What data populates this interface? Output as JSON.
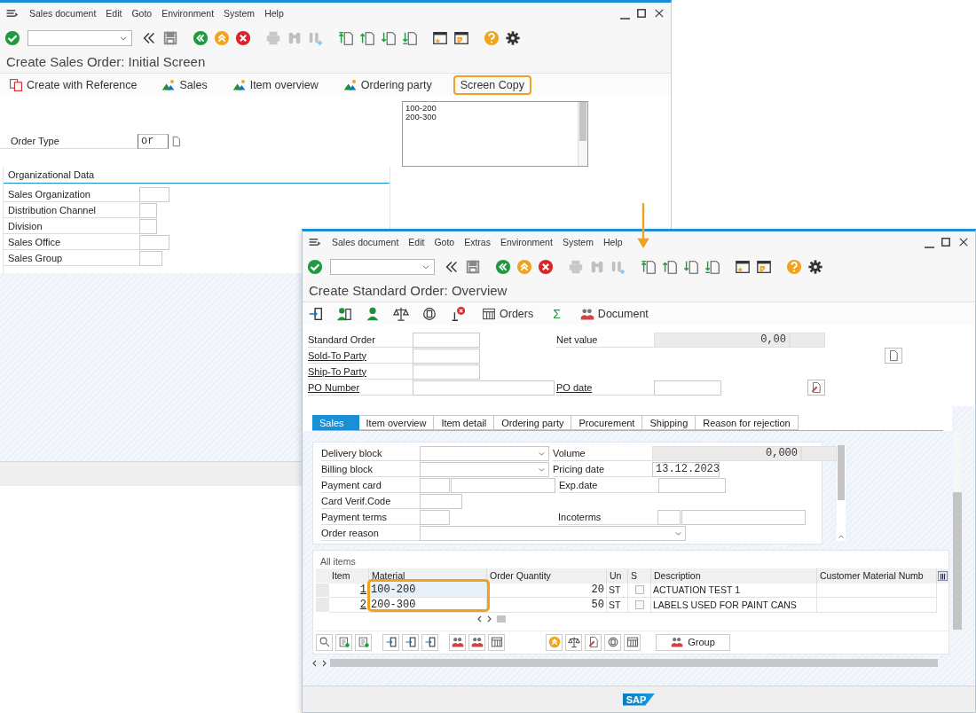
{
  "back_window": {
    "menu": [
      "Sales document",
      "Edit",
      "Goto",
      "Environment",
      "System",
      "Help"
    ],
    "title": "Create Sales Order: Initial Screen",
    "app_toolbar": [
      {
        "label": "Create with Reference",
        "kind": "reference",
        "highlighted": false
      },
      {
        "label": "Sales",
        "kind": "nav",
        "highlighted": false
      },
      {
        "label": "Item overview",
        "kind": "nav",
        "highlighted": false
      },
      {
        "label": "Ordering party",
        "kind": "nav",
        "highlighted": false
      },
      {
        "label": "Screen Copy",
        "kind": "plain",
        "highlighted": true
      }
    ],
    "order_type": {
      "label": "Order Type",
      "value": "or"
    },
    "org_data": {
      "title": "Organizational Data",
      "fields": [
        {
          "label": "Sales Organization"
        },
        {
          "label": "Distribution Channel"
        },
        {
          "label": "Division"
        },
        {
          "label": "Sales Office"
        },
        {
          "label": "Sales Group"
        }
      ]
    },
    "clipboard_list": [
      "100-200",
      "200-300"
    ]
  },
  "front_window": {
    "menu": [
      "Sales document",
      "Edit",
      "Goto",
      "Extras",
      "Environment",
      "System",
      "Help"
    ],
    "title": "Create Standard Order: Overview",
    "app_toolbar": [
      {
        "label": "Orders",
        "kind": "table"
      },
      {
        "label": "Σ",
        "kind": "symbol"
      },
      {
        "label": "Document",
        "kind": "document"
      }
    ],
    "header_rows": [
      {
        "left": {
          "label": "Standard Order",
          "link": false,
          "kind": "field"
        },
        "right": {
          "label": "Net value",
          "kind": "readonly",
          "value": "0,00"
        }
      },
      {
        "left": {
          "label": "Sold-To Party",
          "link": true,
          "kind": "field"
        },
        "right": {
          "kind": "page-button"
        }
      },
      {
        "left": {
          "label": "Ship-To Party",
          "link": true,
          "kind": "field"
        }
      },
      {
        "left": {
          "label": "PO Number",
          "link": true,
          "kind": "wide"
        },
        "right": {
          "label": "PO date",
          "link": true,
          "kind": "field"
        },
        "extra": {
          "kind": "edit-button"
        }
      }
    ],
    "tabs": [
      {
        "label": "Sales",
        "selected": true
      },
      {
        "label": "Item overview",
        "selected": false
      },
      {
        "label": "Item detail",
        "selected": false
      },
      {
        "label": "Ordering party",
        "selected": false
      },
      {
        "label": "Procurement",
        "selected": false
      },
      {
        "label": "Shipping",
        "selected": false
      },
      {
        "label": "Reason for rejection",
        "selected": false
      }
    ],
    "sales_rows": [
      [
        {
          "label": "Delivery block",
          "kind": "dropdown"
        },
        {
          "label": "Volume",
          "kind": "readonly",
          "value": "0,000"
        }
      ],
      [
        {
          "label": "Billing block",
          "kind": "dropdown"
        },
        {
          "label": "Pricing date",
          "kind": "field",
          "value": "13.12.2023"
        }
      ],
      [
        {
          "label": "Payment card",
          "kind": "pair"
        },
        {
          "label": "Exp.date",
          "kind": "field"
        }
      ],
      [
        {
          "label": "Card Verif.Code",
          "kind": "field"
        }
      ],
      [
        {
          "label": "Payment terms",
          "kind": "field"
        },
        {
          "label": "Incoterms",
          "kind": "pair"
        }
      ],
      [
        {
          "label": "Order reason",
          "kind": "wide-dropdown"
        }
      ]
    ],
    "items": {
      "title": "All items",
      "columns": [
        "Item",
        "Material",
        "Order Quantity",
        "Un",
        "S",
        "Description",
        "Customer Material Numb"
      ],
      "rows": [
        {
          "item": "1",
          "material": "100-200",
          "quantity": "20",
          "unit": "ST",
          "checked": false,
          "description": "ACTUATION TEST 1",
          "focused": true
        },
        {
          "item": "2",
          "material": "200-300",
          "quantity": "50",
          "unit": "ST",
          "checked": false,
          "description": "LABELS USED FOR PAINT CANS",
          "focused": false
        }
      ],
      "highlighted": true
    },
    "group_button": "Group",
    "logo": "SAP"
  }
}
